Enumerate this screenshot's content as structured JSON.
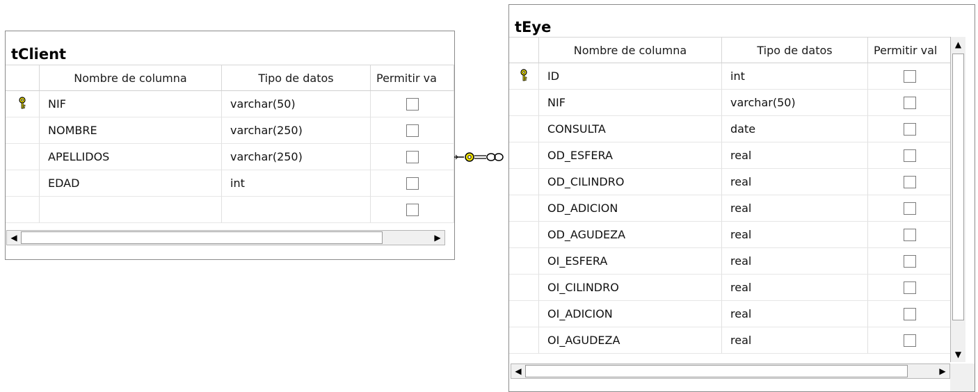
{
  "tables": [
    {
      "title": "tClient",
      "headers": {
        "name": "Nombre de columna",
        "type": "Tipo de datos",
        "nulls": "Permitir va"
      },
      "rows": [
        {
          "name": "NIF",
          "type": "varchar(50)",
          "pk": true
        },
        {
          "name": "NOMBRE",
          "type": "varchar(250)",
          "pk": false
        },
        {
          "name": "APELLIDOS",
          "type": "varchar(250)",
          "pk": false
        },
        {
          "name": "EDAD",
          "type": "int",
          "pk": false
        },
        {
          "name": "",
          "type": "",
          "pk": false
        }
      ]
    },
    {
      "title": "tEye",
      "headers": {
        "name": "Nombre de columna",
        "type": "Tipo de datos",
        "nulls": "Permitir val"
      },
      "rows": [
        {
          "name": "ID",
          "type": "int",
          "pk": true
        },
        {
          "name": "NIF",
          "type": "varchar(50)",
          "pk": false
        },
        {
          "name": "CONSULTA",
          "type": "date",
          "pk": false
        },
        {
          "name": "OD_ESFERA",
          "type": "real",
          "pk": false
        },
        {
          "name": "OD_CILINDRO",
          "type": "real",
          "pk": false
        },
        {
          "name": "OD_ADICION",
          "type": "real",
          "pk": false
        },
        {
          "name": "OD_AGUDEZA",
          "type": "real",
          "pk": false
        },
        {
          "name": "OI_ESFERA",
          "type": "real",
          "pk": false
        },
        {
          "name": "OI_CILINDRO",
          "type": "real",
          "pk": false
        },
        {
          "name": "OI_ADICION",
          "type": "real",
          "pk": false
        },
        {
          "name": "OI_AGUDEZA",
          "type": "real",
          "pk": false
        }
      ]
    }
  ],
  "icons": {
    "primary_key": "key-icon",
    "relationship": "relationship-connector-icon"
  },
  "colors": {
    "key": "#f2e400",
    "border": "#8a8a8a",
    "scrollbar": "#f0f0f0"
  }
}
